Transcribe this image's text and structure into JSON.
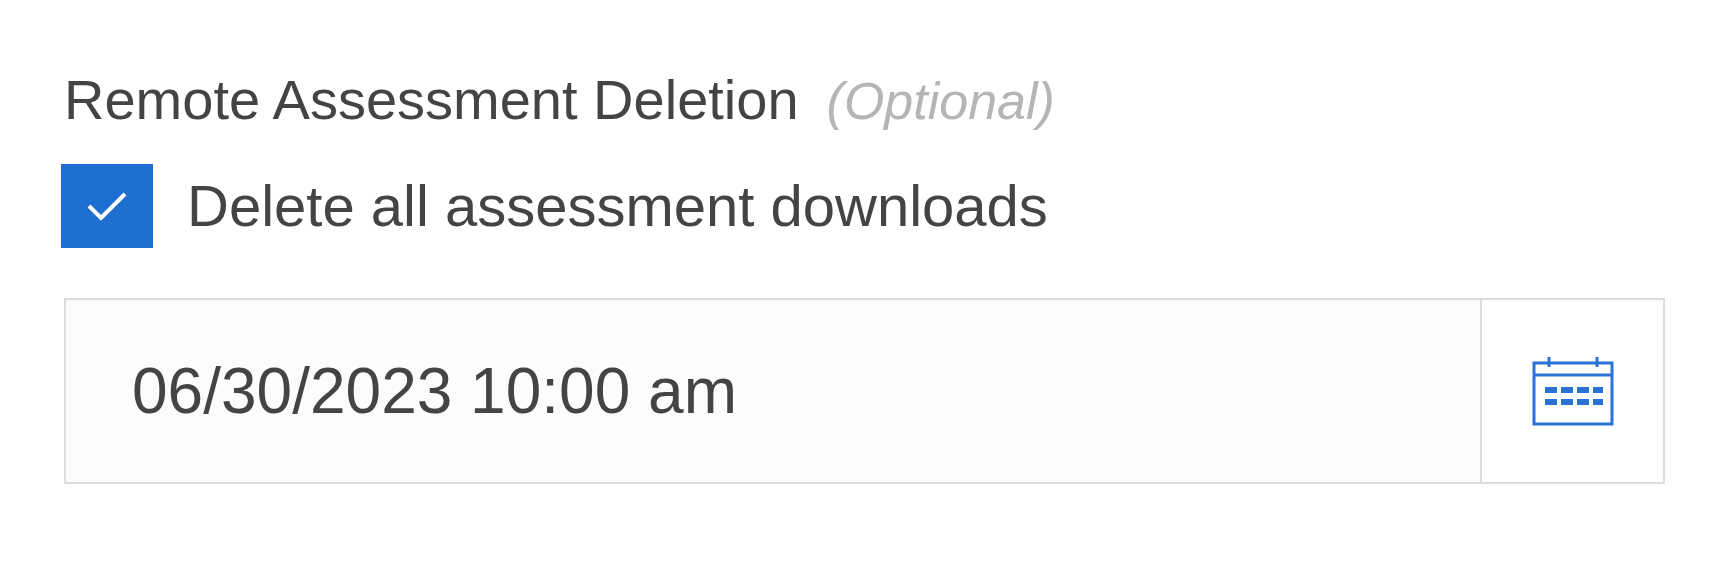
{
  "field_label": {
    "text": "Remote Assessment Deletion",
    "hint": "(Optional)"
  },
  "checkbox": {
    "label": "Delete all assessment downloads",
    "checked": true
  },
  "date_field": {
    "value": "06/30/2023 10:00 am"
  }
}
